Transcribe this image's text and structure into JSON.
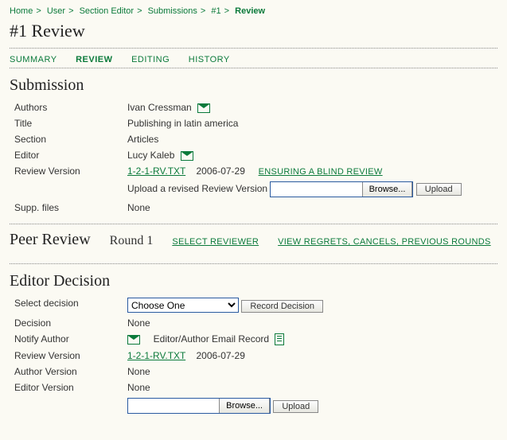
{
  "breadcrumb": {
    "home": "Home",
    "user": "User",
    "section_editor": "Section Editor",
    "submissions": "Submissions",
    "number": "#1",
    "current": "Review"
  },
  "page_title": "#1 Review",
  "tabs": {
    "summary": "SUMMARY",
    "review": "REVIEW",
    "editing": "EDITING",
    "history": "HISTORY"
  },
  "submission": {
    "heading": "Submission",
    "labels": {
      "authors": "Authors",
      "title": "Title",
      "section": "Section",
      "editor": "Editor",
      "review_version": "Review Version",
      "supp_files": "Supp. files"
    },
    "authors": "Ivan Cressman",
    "title": "Publishing in latin america",
    "section": "Articles",
    "editor": "Lucy Kaleb",
    "review_file": "1-2-1-RV.TXT",
    "review_date": "2006-07-29",
    "blind_review": "ENSURING A BLIND REVIEW",
    "upload_label": "Upload a revised Review Version",
    "browse": "Browse...",
    "upload": "Upload",
    "supp_files": "None"
  },
  "peer": {
    "heading": "Peer Review",
    "round": "Round 1",
    "select_reviewer": "SELECT REVIEWER",
    "view_regrets": "VIEW REGRETS, CANCELS, PREVIOUS ROUNDS"
  },
  "decision": {
    "heading": "Editor Decision",
    "labels": {
      "select_decision": "Select decision",
      "decision": "Decision",
      "notify_author": "Notify Author",
      "review_version": "Review Version",
      "author_version": "Author Version",
      "editor_version": "Editor Version"
    },
    "select_option": "Choose One",
    "record_decision": "Record Decision",
    "decision_value": "None",
    "email_record": "Editor/Author Email Record",
    "review_file": "1-2-1-RV.TXT",
    "review_date": "2006-07-29",
    "author_version": "None",
    "editor_version": "None",
    "browse": "Browse...",
    "upload": "Upload"
  }
}
